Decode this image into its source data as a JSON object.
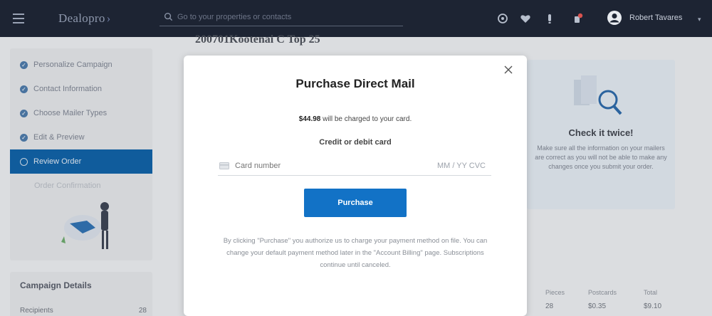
{
  "header": {
    "logo": "Dealopro",
    "search_placeholder": "Go to your properties or contacts",
    "user_name": "Robert Tavares"
  },
  "sidebar": {
    "steps": [
      {
        "label": "Personalize Campaign"
      },
      {
        "label": "Contact Information"
      },
      {
        "label": "Choose Mailer Types"
      },
      {
        "label": "Edit & Preview"
      },
      {
        "label": "Review Order"
      },
      {
        "label": "Order Confirmation"
      }
    ],
    "campaign_details_title": "Campaign Details",
    "recipients_label": "Recipients",
    "recipients_value": "28"
  },
  "main": {
    "title": "200701Kootenai C Top 25",
    "tip_title": "Check it twice!",
    "tip_body": "Make sure all the information on your mailers are correct as you will not be able to make any changes once you submit your order.",
    "summary": [
      {
        "label": "Pieces",
        "value": "28"
      },
      {
        "label": "Postcards",
        "value": "$0.35"
      },
      {
        "label": "Total",
        "value": "$9.10"
      }
    ]
  },
  "modal": {
    "title": "Purchase Direct Mail",
    "amount": "$44.98",
    "charge_suffix": " will be charged to your card.",
    "card_label": "Credit or debit card",
    "card_placeholder": "Card number",
    "card_exp_cvc": "MM / YY  CVC",
    "purchase_label": "Purchase",
    "disclaimer": "By clicking \"Purchase\" you authorize us to charge your payment method on file. You can change your default payment method later in the \"Account Billing\" page. Subscriptions continue until canceled."
  },
  "colors": {
    "topbar": "#1d2433",
    "accent": "#1272c6",
    "active_step": "#0d5fa4"
  }
}
